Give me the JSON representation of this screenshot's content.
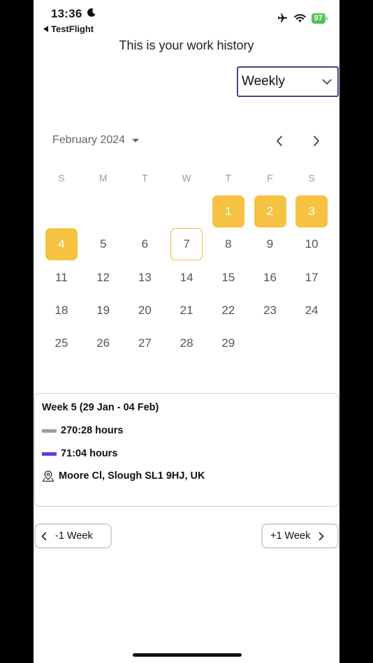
{
  "status_bar": {
    "time": "13:36",
    "back_app": "TestFlight",
    "battery": "97"
  },
  "page": {
    "title": "This is your work history"
  },
  "period_select": {
    "value": "Weekly"
  },
  "calendar": {
    "month_label": "February 2024",
    "weekdays": [
      "S",
      "M",
      "T",
      "W",
      "T",
      "F",
      "S"
    ],
    "days": [
      "1",
      "2",
      "3",
      "4",
      "5",
      "6",
      "7",
      "8",
      "9",
      "10",
      "11",
      "12",
      "13",
      "14",
      "15",
      "16",
      "17",
      "18",
      "19",
      "20",
      "21",
      "22",
      "23",
      "24",
      "25",
      "26",
      "27",
      "28",
      "29"
    ],
    "selected_days": [
      1,
      2,
      3,
      4
    ],
    "today": 7,
    "selected_color": "#f5c242"
  },
  "week_summary": {
    "title": "Week 5 (29 Jan - 04 Feb)",
    "hours_total": "270:28 hours",
    "hours_worked": "71:04 hours",
    "location": "Moore Cl, Slough SL1 9HJ, UK",
    "colors": {
      "total": "#9e9e9e",
      "worked": "#6a35e0"
    }
  },
  "week_nav": {
    "prev_label": "-1 Week",
    "next_label": "+1 Week"
  }
}
